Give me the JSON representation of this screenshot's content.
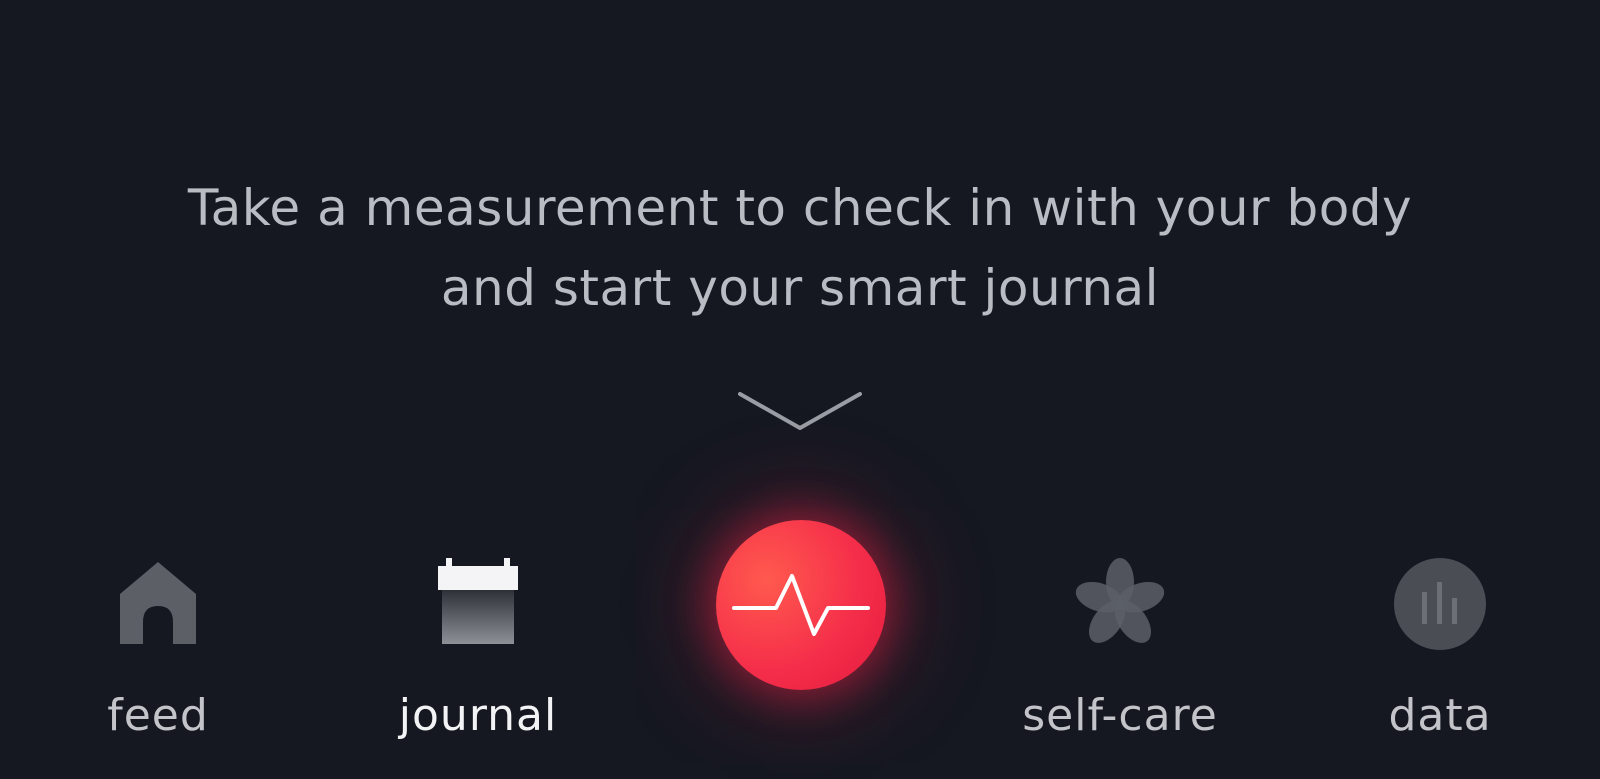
{
  "prompt": {
    "line1": "Take a measurement to check in with your body",
    "line2": "and start your smart journal"
  },
  "measure_button": {
    "icon": "heartbeat-pulse-icon",
    "color": "#f52f4a"
  },
  "tabs": [
    {
      "id": "feed",
      "label": "feed",
      "icon": "home-icon",
      "active": false
    },
    {
      "id": "journal",
      "label": "journal",
      "icon": "calendar-icon",
      "active": true
    },
    {
      "id": "self-care",
      "label": "self-care",
      "icon": "flower-icon",
      "active": false
    },
    {
      "id": "data",
      "label": "data",
      "icon": "bar-chart-icon",
      "active": false
    }
  ],
  "colors": {
    "background": "#151821",
    "text": "#b9bcc3",
    "accent": "#f52f4a"
  }
}
